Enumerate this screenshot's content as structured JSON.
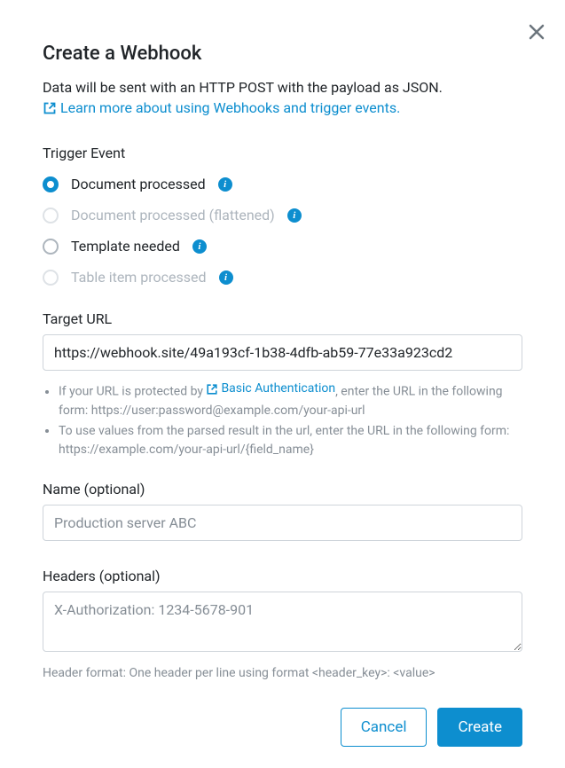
{
  "title": "Create a Webhook",
  "subtitle": "Data will be sent with an HTTP POST with the payload as JSON.",
  "learnMoreLabel": "Learn more about using Webhooks and trigger events.",
  "triggerEvent": {
    "label": "Trigger Event",
    "options": [
      {
        "label": "Document processed",
        "selected": true,
        "disabled": false
      },
      {
        "label": "Document processed (flattened)",
        "selected": false,
        "disabled": true
      },
      {
        "label": "Template needed",
        "selected": false,
        "disabled": false
      },
      {
        "label": "Table item processed",
        "selected": false,
        "disabled": true
      }
    ]
  },
  "targetUrl": {
    "label": "Target URL",
    "value": "https://webhook.site/49a193cf-1b38-4dfb-ab59-77e33a923cd2",
    "helper": {
      "item1_pre": "If your URL is protected by ",
      "item1_link": "Basic Authentication",
      "item1_post": ", enter the URL in the following form: https://user:password@example.com/your-api-url",
      "item2": "To use values from the parsed result in the url, enter the URL in the following form: https://example.com/your-api-url/{field_name}"
    }
  },
  "name": {
    "label": "Name (optional)",
    "placeholder": "Production server ABC",
    "value": ""
  },
  "headers": {
    "label": "Headers (optional)",
    "placeholder": "X-Authorization: 1234-5678-901",
    "value": "",
    "helper": "Header format: One header per line using format <header_key>: <value>"
  },
  "buttons": {
    "cancel": "Cancel",
    "create": "Create"
  }
}
